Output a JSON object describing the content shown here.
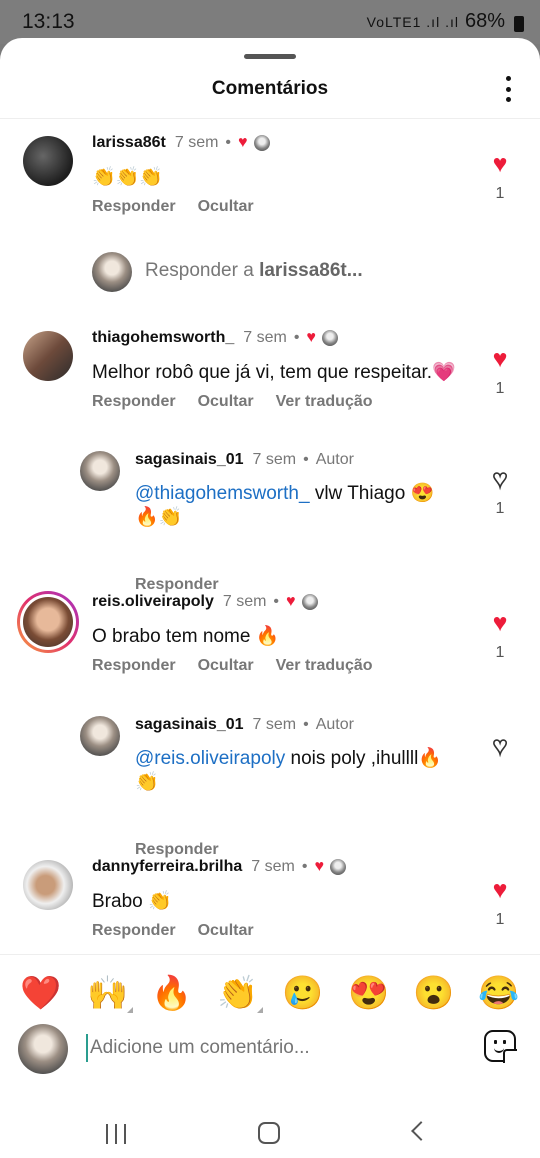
{
  "status_bar": {
    "time": "13:13",
    "network_icons": "VoLTE1 .ıl .ıl",
    "battery": "68%"
  },
  "header": {
    "title": "Comentários",
    "menu_icon": "more-vertical-icon"
  },
  "labels": {
    "reply": "Responder",
    "hide": "Ocultar",
    "translate": "Ver tradução"
  },
  "comments": [
    {
      "username": "larissa86t",
      "time": "7 sem",
      "text": "👏👏👏",
      "likes": "1"
    },
    {
      "username": "thiagohemsworth_",
      "time": "7 sem",
      "text": "Melhor robô que já vi, tem que respeitar.💗",
      "likes": "1"
    },
    {
      "username": "sagasinais_01",
      "time": "7 sem",
      "badge": "Autor",
      "mention": "@thiagohemsworth_",
      "text": " vlw Thiago 😍",
      "text2": "🔥👏",
      "likes": "1"
    },
    {
      "username": "reis.oliveirapoly",
      "time": "7 sem",
      "text": "O brabo tem nome 🔥",
      "likes": "1"
    },
    {
      "username": "sagasinais_01",
      "time": "7 sem",
      "badge": "Autor",
      "mention": "@reis.oliveirapoly",
      "text": " nois poly ,ihullll🔥",
      "text2": "👏"
    },
    {
      "username": "dannyferreira.brilha",
      "time": "7 sem",
      "text": "Brabo 👏",
      "likes": "1"
    }
  ],
  "reply_prompt": {
    "prefix": "Responder a",
    "username": "larissa86t..."
  },
  "emoji_bar": [
    "❤️",
    "🙌",
    "🔥",
    "👏",
    "🥲",
    "😍",
    "😮",
    "😂"
  ],
  "composer": {
    "placeholder": "Adicione um comentário..."
  },
  "colors": {
    "like_red": "#ed1c3a",
    "mention_blue": "#1d6fc4"
  }
}
